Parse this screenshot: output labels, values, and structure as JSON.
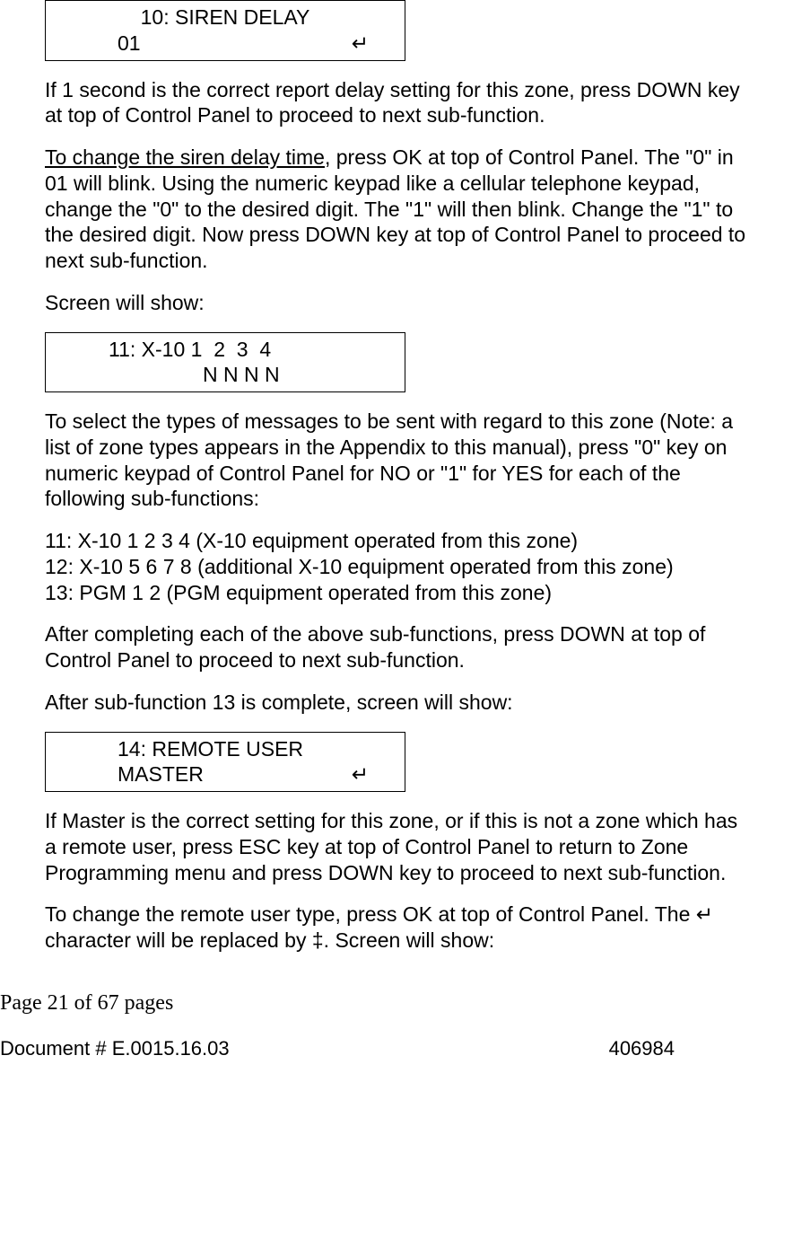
{
  "lcd1": {
    "line1": "10: SIREN DELAY",
    "line2_left": "01",
    "line2_right": "↵"
  },
  "para1": "If 1 second is the correct report delay setting for this zone, press DOWN key at top of Control Panel to proceed to next sub-function.",
  "para2_underline": "To change the siren delay time",
  "para2_rest": ", press OK at top of Control Panel. The \"0\" in 01 will blink. Using the numeric keypad like a cellular telephone keypad, change the \"0\" to the desired digit. The \"1\" will then blink. Change the \"1\" to the desired digit. Now press DOWN key at top of Control Panel to proceed to next sub-function.",
  "para3": "Screen will show:",
  "lcd2": {
    "line1": "11: X-10 1  2  3  4",
    "line2": "N N N N"
  },
  "para4": "To select the types of messages to be sent with regard to this zone (Note: a list of zone types appears in the Appendix to this manual), press \"0\" key on numeric keypad of Control Panel for NO or \"1\" for YES for each of the following sub-functions:",
  "list": {
    "i1": "11: X-10  1  2  3  4 (X-10 equipment operated from this zone)",
    "i2": "12: X-10  5  6  7  8 (additional X-10 equipment operated from this zone)",
    "i3": "13: PGM  1  2 (PGM equipment operated from this zone)"
  },
  "para5": "After completing each of the above sub-functions, press DOWN at top of Control Panel to proceed to next sub-function.",
  "para6": "After sub-function 13 is complete, screen will show:",
  "lcd3": {
    "line1": "14: REMOTE USER",
    "line2_left": "MASTER",
    "line2_right": "↵"
  },
  "para7": "If Master is the correct setting for this zone, or if this is not a zone which has a remote user, press ESC key at top of Control Panel to return to Zone Programming menu and press DOWN key to proceed to next sub-function.",
  "para8": "To change the remote user type, press OK at top of Control Panel. The ↵ character will be replaced by ‡. Screen will show:",
  "footer": {
    "page": "Page 21 of  67 pages",
    "doc": "Document # E.0015.16.03",
    "num": "406984"
  }
}
